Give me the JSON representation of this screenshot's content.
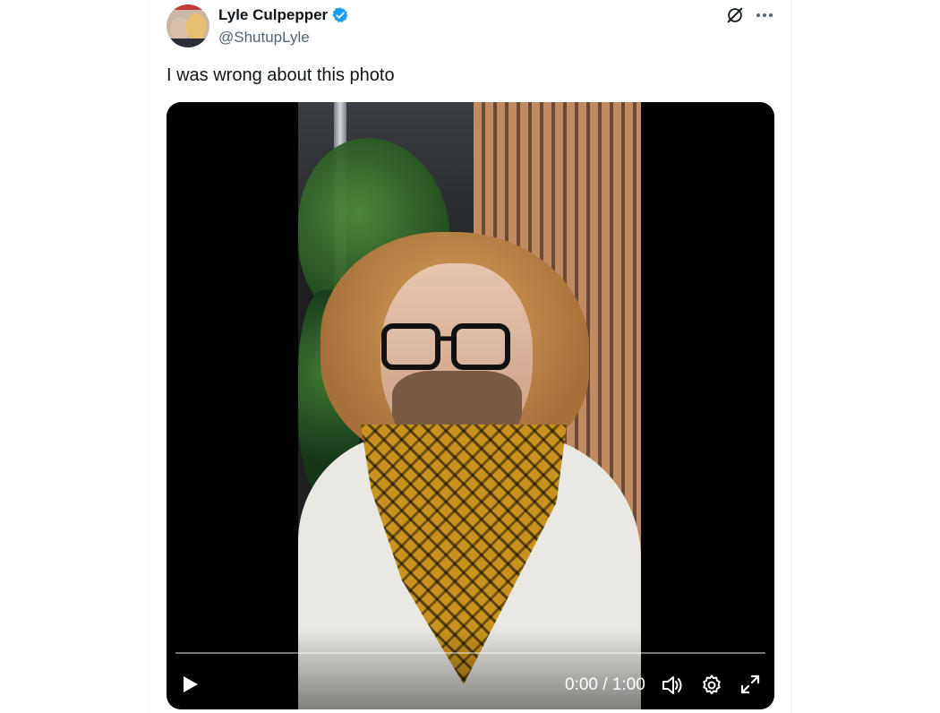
{
  "author": {
    "display_name": "Lyle Culpepper",
    "handle": "@ShutupLyle",
    "verified": true
  },
  "tweet": {
    "text": "I was wrong about this photo"
  },
  "video": {
    "current_time": "0:00",
    "separator": "/",
    "duration": "1:00",
    "time_display": "0:00 / 1:00",
    "progress": 0
  },
  "icons": {
    "verified": "verified-badge-icon",
    "grok": "grok-icon",
    "more": "more-icon",
    "play": "play-icon",
    "volume": "volume-icon",
    "settings": "settings-icon",
    "fullscreen": "fullscreen-icon"
  },
  "colors": {
    "verified_blue": "#1d9bf0",
    "text_primary": "#0f1419",
    "text_secondary": "#536471"
  }
}
